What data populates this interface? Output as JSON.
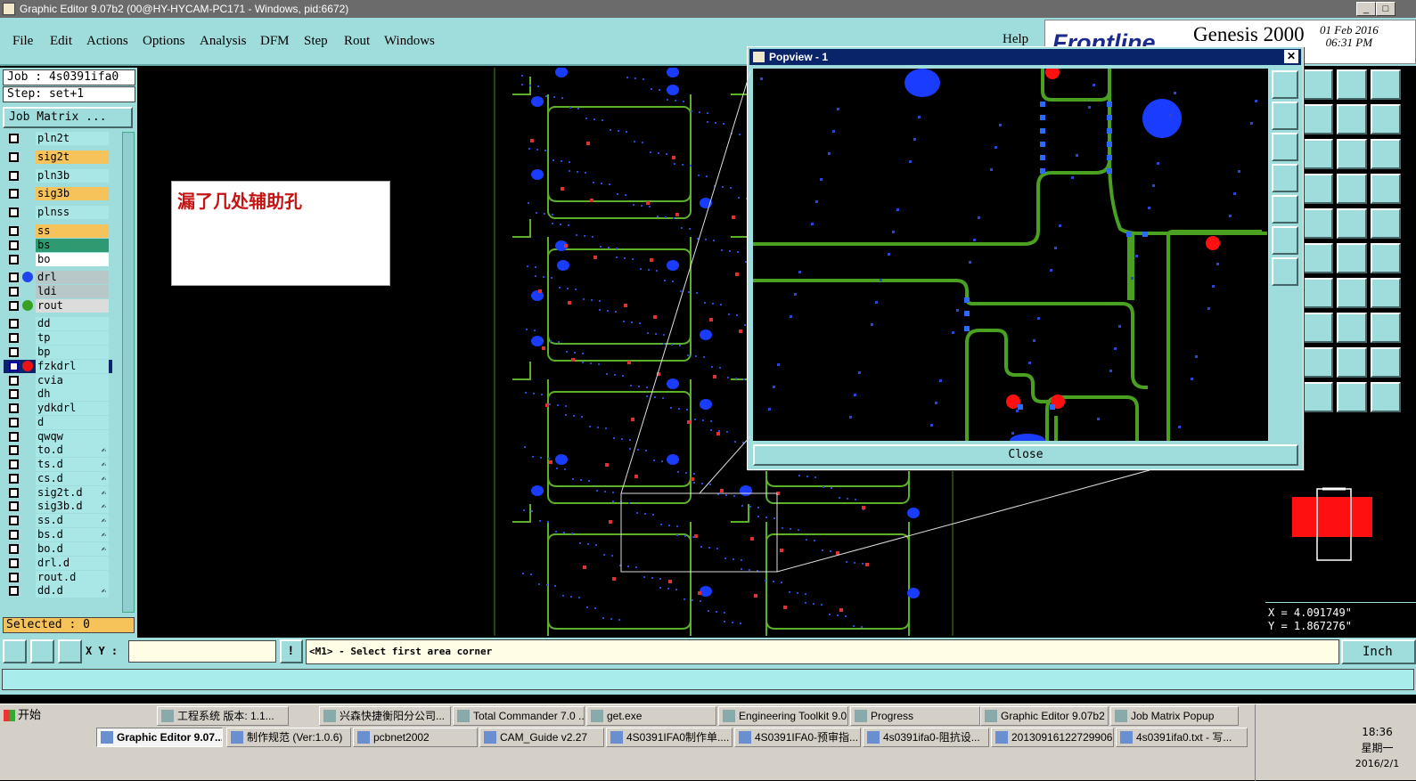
{
  "window": {
    "title": "Graphic Editor 9.07b2 (00@HY-HYCAM-PC171 - Windows, pid:6672)"
  },
  "menu": {
    "items": [
      "File",
      "Edit",
      "Actions",
      "Options",
      "Analysis",
      "DFM",
      "Step",
      "Rout",
      "Windows"
    ],
    "help": "Help"
  },
  "brand": {
    "logo": "Frontline",
    "product": "Genesis 2000",
    "date": "01 Feb 2016",
    "time": "06:31 PM"
  },
  "job": {
    "job_label": "Job : 4s0391ifa0",
    "step_label": "Step: set+1",
    "matrix_button": "Job Matrix ..."
  },
  "layers": [
    {
      "name": "pln2t",
      "color": "#a9e6e6"
    },
    {
      "name": "sig2t",
      "color": "#f6c25a"
    },
    {
      "name": "pln3b",
      "color": "#a9e6e6"
    },
    {
      "name": "sig3b",
      "color": "#f6c25a"
    },
    {
      "name": "plnss",
      "color": "#a9e6e6"
    },
    {
      "name": "ss",
      "color": "#f6c25a"
    },
    {
      "name": "bs",
      "color": "#2f9a72"
    },
    {
      "name": "bo",
      "color": "#ffffff"
    },
    {
      "name": "drl",
      "color": "#b8c8c8",
      "dot": "#2244ee"
    },
    {
      "name": "ldi",
      "color": "#b8c8c8"
    },
    {
      "name": "rout",
      "color": "#dcdcdc",
      "dot": "#3aa024"
    },
    {
      "name": "dd",
      "color": "#a9e6e6"
    },
    {
      "name": "tp",
      "color": "#a9e6e6"
    },
    {
      "name": "bp",
      "color": "#a9e6e6"
    },
    {
      "name": "fzkdrl",
      "color": "#a9e6e6",
      "dot": "#ee1111",
      "active": true
    },
    {
      "name": "cvia",
      "color": "#a9e6e6"
    },
    {
      "name": "dh",
      "color": "#a9e6e6"
    },
    {
      "name": "ydkdrl",
      "color": "#a9e6e6"
    },
    {
      "name": "d",
      "color": "#a9e6e6"
    },
    {
      "name": "qwqw",
      "color": "#a9e6e6"
    },
    {
      "name": "to.d",
      "color": "#a9e6e6",
      "mark": "✍"
    },
    {
      "name": "ts.d",
      "color": "#a9e6e6",
      "mark": "✍"
    },
    {
      "name": "cs.d",
      "color": "#a9e6e6",
      "mark": "✍"
    },
    {
      "name": "sig2t.d",
      "color": "#a9e6e6",
      "mark": "✍"
    },
    {
      "name": "sig3b.d",
      "color": "#a9e6e6",
      "mark": "✍"
    },
    {
      "name": "ss.d",
      "color": "#a9e6e6",
      "mark": "✍"
    },
    {
      "name": "bs.d",
      "color": "#a9e6e6",
      "mark": "✍"
    },
    {
      "name": "bo.d",
      "color": "#a9e6e6",
      "mark": "✍"
    },
    {
      "name": "drl.d",
      "color": "#a9e6e6"
    },
    {
      "name": "rout.d",
      "color": "#a9e6e6"
    },
    {
      "name": "dd.d",
      "color": "#a9e6e6",
      "mark": "✍"
    }
  ],
  "selected_label": "Selected : 0",
  "note": {
    "text": "漏了几处辅助孔"
  },
  "popview": {
    "title": "Popview - 1",
    "close_x": "✕",
    "close_button": "Close"
  },
  "coords": {
    "x": "X = 4.091749\"",
    "y": "Y = 1.867276\""
  },
  "command": {
    "xy_label": "X Y :",
    "xy_value": "",
    "prompt": "<M1> - Select first area corner",
    "units": "Inch"
  },
  "taskbar": {
    "start": "开始",
    "row1": [
      "工程系统  版本: 1.1...",
      "兴森快捷衡阳分公司...",
      "Total Commander 7.0 ...",
      "get.exe",
      "Engineering Toolkit 9.0...",
      "Progress",
      "Graphic Editor 9.07b2 ...",
      "Job Matrix Popup"
    ],
    "row2": [
      "Graphic Editor 9.07...",
      "制作规范 (Ver:1.0.6)",
      "pcbnet2002",
      "CAM_Guide v2.27",
      "4S0391IFA0制作单....",
      "4S0391IFA0-预审指...",
      "4s0391ifa0-阻抗设...",
      "20130916122729906...",
      "4s0391ifa0.txt - 写..."
    ],
    "clock": {
      "time": "18:36",
      "day": "星期一",
      "date": "2016/2/1"
    }
  }
}
